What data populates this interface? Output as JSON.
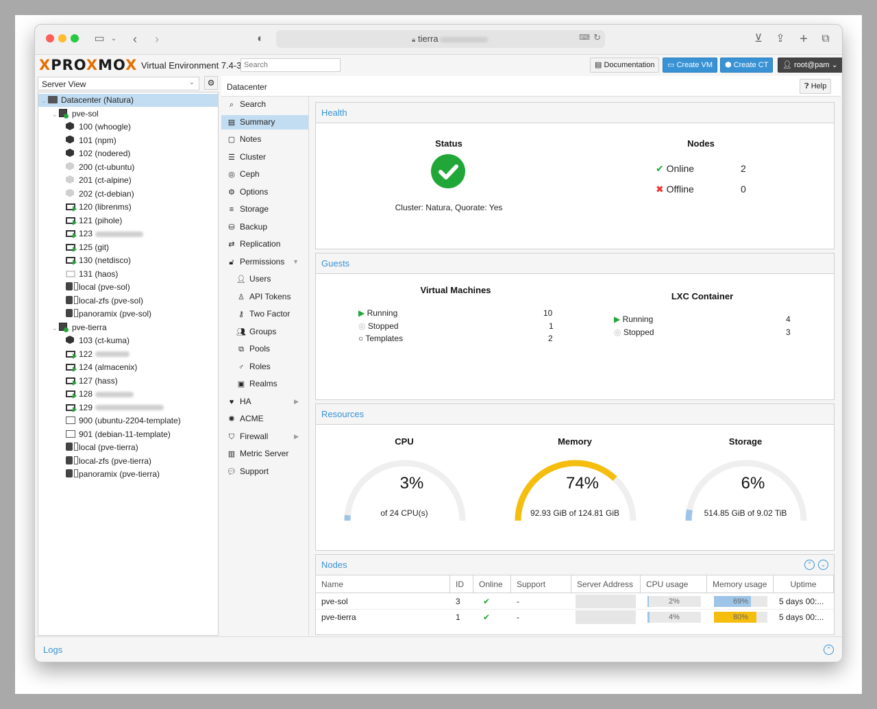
{
  "browser": {
    "url": "tierra"
  },
  "header": {
    "product": "PROXMOX",
    "version": "Virtual Environment 7.4-3",
    "search_placeholder": "Search",
    "documentation": "Documentation",
    "create_vm": "Create VM",
    "create_ct": "Create CT",
    "user": "root@pam"
  },
  "view_selector": "Server View",
  "tree": {
    "items": [
      {
        "label": "Datacenter (Natura)",
        "icon": "datacenter-icon"
      },
      {
        "label": "pve-sol",
        "icon": "node-icon"
      },
      {
        "label": "100 (whoogle)",
        "icon": "ct-running-icon"
      },
      {
        "label": "101 (npm)",
        "icon": "ct-running-icon"
      },
      {
        "label": "102 (nodered)",
        "icon": "ct-running-icon"
      },
      {
        "label": "200 (ct-ubuntu)",
        "icon": "ct-stopped-icon"
      },
      {
        "label": "201 (ct-alpine)",
        "icon": "ct-stopped-icon"
      },
      {
        "label": "202 (ct-debian)",
        "icon": "ct-stopped-icon"
      },
      {
        "label": "120 (librenms)",
        "icon": "vm-running-icon"
      },
      {
        "label": "121 (pihole)",
        "icon": "vm-running-icon"
      },
      {
        "label": "123",
        "icon": "vm-running-icon"
      },
      {
        "label": "125 (git)",
        "icon": "vm-running-icon"
      },
      {
        "label": "130 (netdisco)",
        "icon": "vm-running-icon"
      },
      {
        "label": "131 (haos)",
        "icon": "vm-stopped-icon"
      },
      {
        "label": "local (pve-sol)",
        "icon": "storage-icon"
      },
      {
        "label": "local-zfs (pve-sol)",
        "icon": "storage-icon"
      },
      {
        "label": "panoramix (pve-sol)",
        "icon": "storage-icon"
      },
      {
        "label": "pve-tierra",
        "icon": "node-icon"
      },
      {
        "label": "103 (ct-kuma)",
        "icon": "ct-running-icon"
      },
      {
        "label": "122",
        "icon": "vm-running-icon"
      },
      {
        "label": "124 (almacenix)",
        "icon": "vm-running-icon"
      },
      {
        "label": "127 (hass)",
        "icon": "vm-running-icon"
      },
      {
        "label": "128",
        "icon": "vm-running-icon"
      },
      {
        "label": "129",
        "icon": "vm-running-icon"
      },
      {
        "label": "900 (ubuntu-2204-template)",
        "icon": "template-icon"
      },
      {
        "label": "901 (debian-11-template)",
        "icon": "template-icon"
      },
      {
        "label": "local (pve-tierra)",
        "icon": "storage-icon"
      },
      {
        "label": "local-zfs (pve-tierra)",
        "icon": "storage-icon"
      },
      {
        "label": "panoramix (pve-tierra)",
        "icon": "storage-icon"
      }
    ]
  },
  "breadcrumb": "Datacenter",
  "help": "Help",
  "nav": {
    "items": [
      {
        "label": "Search",
        "icon": "search-icon"
      },
      {
        "label": "Summary",
        "icon": "book-icon"
      },
      {
        "label": "Notes",
        "icon": "notes-icon"
      },
      {
        "label": "Cluster",
        "icon": "cluster-icon"
      },
      {
        "label": "Ceph",
        "icon": "ceph-icon"
      },
      {
        "label": "Options",
        "icon": "gear-icon"
      },
      {
        "label": "Storage",
        "icon": "database-icon"
      },
      {
        "label": "Backup",
        "icon": "backup-icon"
      },
      {
        "label": "Replication",
        "icon": "replication-icon"
      },
      {
        "label": "Permissions",
        "icon": "unlock-icon"
      },
      {
        "label": "Users",
        "icon": "user-icon"
      },
      {
        "label": "API Tokens",
        "icon": "user-outline-icon"
      },
      {
        "label": "Two Factor",
        "icon": "key-icon"
      },
      {
        "label": "Groups",
        "icon": "users-icon"
      },
      {
        "label": "Pools",
        "icon": "tags-icon"
      },
      {
        "label": "Roles",
        "icon": "male-icon"
      },
      {
        "label": "Realms",
        "icon": "address-book-icon"
      },
      {
        "label": "HA",
        "icon": "heartbeat-icon"
      },
      {
        "label": "ACME",
        "icon": "certificate-icon"
      },
      {
        "label": "Firewall",
        "icon": "shield-icon"
      },
      {
        "label": "Metric Server",
        "icon": "bar-chart-icon"
      },
      {
        "label": "Support",
        "icon": "comments-icon"
      }
    ]
  },
  "health": {
    "title": "Health",
    "status_title": "Status",
    "status_text": "Cluster: Natura, Quorate: Yes",
    "nodes_title": "Nodes",
    "online_label": "Online",
    "online_count": "2",
    "offline_label": "Offline",
    "offline_count": "0"
  },
  "guests": {
    "title": "Guests",
    "vm_title": "Virtual Machines",
    "vm_running_label": "Running",
    "vm_running": "10",
    "vm_stopped_label": "Stopped",
    "vm_stopped": "1",
    "vm_templates_label": "Templates",
    "vm_templates": "2",
    "lxc_title": "LXC Container",
    "lxc_running_label": "Running",
    "lxc_running": "4",
    "lxc_stopped_label": "Stopped",
    "lxc_stopped": "3"
  },
  "resources": {
    "title": "Resources",
    "cpu": {
      "title": "CPU",
      "pct": "3%",
      "value": 0.03,
      "text": "of 24 CPU(s)",
      "color": "#9ec5e8"
    },
    "memory": {
      "title": "Memory",
      "pct": "74%",
      "value": 0.74,
      "text": "92.93 GiB of 124.81 GiB",
      "color": "#f5bd0e"
    },
    "storage": {
      "title": "Storage",
      "pct": "6%",
      "value": 0.06,
      "text": "514.85 GiB of 9.02 TiB",
      "color": "#9ec5e8"
    }
  },
  "nodes_table": {
    "title": "Nodes",
    "columns": [
      "Name",
      "ID",
      "Online",
      "Support",
      "Server Address",
      "CPU usage",
      "Memory usage",
      "Uptime"
    ],
    "rows": [
      {
        "name": "pve-sol",
        "id": "3",
        "online": "✔",
        "support": "-",
        "cpu": "2%",
        "cpu_v": 0.02,
        "mem": "69%",
        "mem_v": 0.69,
        "uptime": "5 days 00:..."
      },
      {
        "name": "pve-tierra",
        "id": "1",
        "online": "✔",
        "support": "-",
        "cpu": "4%",
        "cpu_v": 0.04,
        "mem": "80%",
        "mem_v": 0.8,
        "uptime": "5 days 00:..."
      }
    ]
  },
  "logs": {
    "title": "Logs"
  },
  "colors": {
    "accent": "#3892d4",
    "success": "#21a738",
    "error": "#e33",
    "warning": "#f5bd0e"
  }
}
